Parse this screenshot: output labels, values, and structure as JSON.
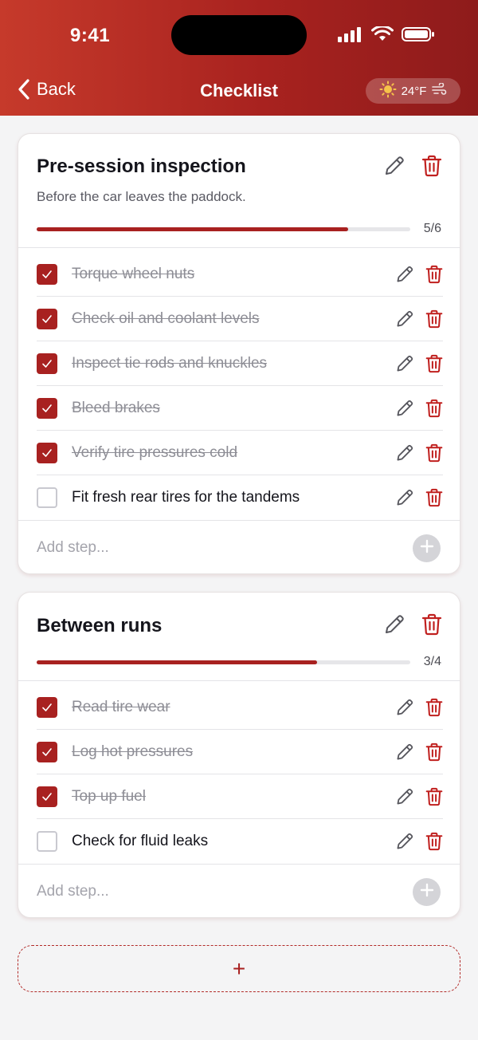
{
  "status": {
    "time": "9:41"
  },
  "nav": {
    "back_label": "Back",
    "title": "Checklist"
  },
  "weather": {
    "temp": "24°F",
    "icon": "sun-icon",
    "wind_icon": "wind-icon"
  },
  "colors": {
    "accent": "#a82120",
    "header_start": "#c63a2b",
    "header_end": "#8e1b1b"
  },
  "lists": [
    {
      "title": "Pre-session inspection",
      "description": "Before the car leaves the paddock.",
      "progress_text": "5/6",
      "progress": 0.833,
      "add_placeholder": "Add step...",
      "steps": [
        {
          "label": "Torque wheel nuts",
          "done": true
        },
        {
          "label": "Check oil and coolant levels",
          "done": true
        },
        {
          "label": "Inspect tie rods and knuckles",
          "done": true
        },
        {
          "label": "Bleed brakes",
          "done": true
        },
        {
          "label": "Verify tire pressures cold",
          "done": true
        },
        {
          "label": "Fit fresh rear tires for the tandems",
          "done": false
        }
      ]
    },
    {
      "title": "Between runs",
      "description": "",
      "progress_text": "3/4",
      "progress": 0.75,
      "add_placeholder": "Add step...",
      "steps": [
        {
          "label": "Read tire wear",
          "done": true
        },
        {
          "label": "Log hot pressures",
          "done": true
        },
        {
          "label": "Top up fuel",
          "done": true
        },
        {
          "label": "Check for fluid leaks",
          "done": false
        }
      ]
    }
  ],
  "new_list": {
    "label": "+"
  }
}
